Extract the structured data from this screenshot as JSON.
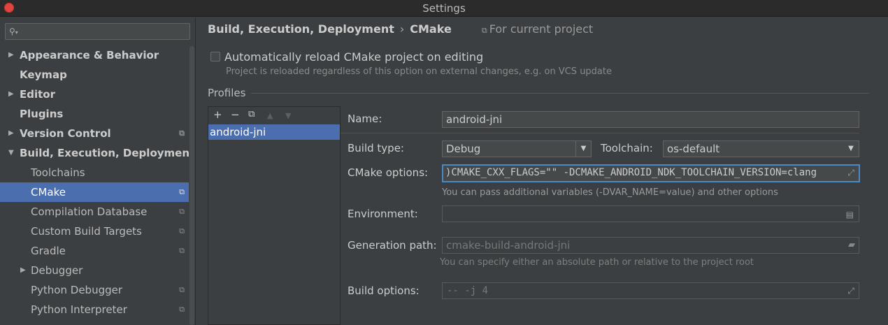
{
  "window": {
    "title": "Settings"
  },
  "search": {
    "placeholder": ""
  },
  "sidebar": {
    "items": [
      {
        "label": "Appearance & Behavior",
        "bold": true,
        "arrow": "right",
        "level": 0,
        "project": false
      },
      {
        "label": "Keymap",
        "bold": true,
        "arrow": "",
        "level": 0,
        "project": false
      },
      {
        "label": "Editor",
        "bold": true,
        "arrow": "right",
        "level": 0,
        "project": false
      },
      {
        "label": "Plugins",
        "bold": true,
        "arrow": "",
        "level": 0,
        "project": false
      },
      {
        "label": "Version Control",
        "bold": true,
        "arrow": "right",
        "level": 0,
        "project": true
      },
      {
        "label": "Build, Execution, Deployment",
        "bold": true,
        "arrow": "down",
        "level": 0,
        "project": false
      },
      {
        "label": "Toolchains",
        "bold": false,
        "arrow": "",
        "level": 1,
        "project": false
      },
      {
        "label": "CMake",
        "bold": false,
        "arrow": "",
        "level": 1,
        "project": true,
        "selected": true
      },
      {
        "label": "Compilation Database",
        "bold": false,
        "arrow": "",
        "level": 1,
        "project": true
      },
      {
        "label": "Custom Build Targets",
        "bold": false,
        "arrow": "",
        "level": 1,
        "project": true
      },
      {
        "label": "Gradle",
        "bold": false,
        "arrow": "",
        "level": 1,
        "project": true
      },
      {
        "label": "Debugger",
        "bold": false,
        "arrow": "right",
        "level": 1,
        "project": false
      },
      {
        "label": "Python Debugger",
        "bold": false,
        "arrow": "",
        "level": 1,
        "project": true
      },
      {
        "label": "Python Interpreter",
        "bold": false,
        "arrow": "",
        "level": 1,
        "project": true
      }
    ]
  },
  "breadcrumb": {
    "parent": "Build, Execution, Deployment",
    "separator": "›",
    "current": "CMake",
    "scope": "For current project"
  },
  "auto_reload": {
    "label": "Automatically reload CMake project on editing",
    "checked": false,
    "hint": "Project is reloaded regardless of this option on external changes, e.g. on VCS update"
  },
  "profiles": {
    "title": "Profiles",
    "toolbar": {
      "add": "+",
      "remove": "−",
      "copy": "⧉",
      "up": "▲",
      "down": "▼"
    },
    "items": [
      "android-jni"
    ],
    "selected": "android-jni"
  },
  "form": {
    "name_label": "Name:",
    "name_value": "android-jni",
    "build_type_label": "Build type:",
    "build_type_value": "Debug",
    "toolchain_label": "Toolchain:",
    "toolchain_value": "os-default",
    "cmake_options_label": "CMake options:",
    "cmake_options_value": ")CMAKE_CXX_FLAGS=\"\" -DCMAKE_ANDROID_NDK_TOOLCHAIN_VERSION=clang",
    "cmake_options_hint": "You can pass additional variables (-DVAR_NAME=value) and other options",
    "environment_label": "Environment:",
    "environment_value": "",
    "generation_path_label": "Generation path:",
    "generation_path_value": "cmake-build-android-jni",
    "generation_path_hint": "You can specify either an absolute path or relative to the project root",
    "build_options_label": "Build options:",
    "build_options_value": "-- -j 4"
  },
  "icons": {
    "project_scope": "copy-icon",
    "expand": "expand-icon",
    "dropdown": "chevron-down-icon",
    "environment": "note-icon",
    "folder": "folder-icon"
  },
  "colors": {
    "background": "#3c3f41",
    "selection": "#4b6eaf",
    "focus": "#4a88c7",
    "close_button": "#e0443e"
  }
}
